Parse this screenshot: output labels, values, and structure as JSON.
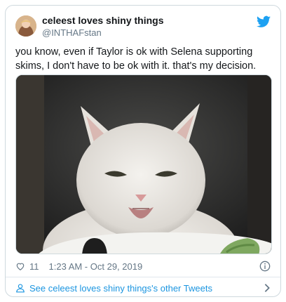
{
  "tweet": {
    "display_name": "celeest loves shiny things",
    "handle": "@INTHAFstan",
    "text": "you know, even if Taylor is ok with Selena supporting skims, I don't have to be ok with it. that's my decision.",
    "likes": "11",
    "timestamp": "1:23 AM - Oct 29, 2019",
    "footer_link": "See celeest loves shiny things's other Tweets"
  },
  "colors": {
    "link_blue": "#1b95e0",
    "muted_gray": "#657786",
    "twitter_blue": "#1da1f2"
  },
  "icons": {
    "brand": "twitter-bird-icon",
    "like": "heart-icon",
    "info": "info-icon",
    "profile": "person-icon",
    "next": "chevron-right-icon"
  }
}
